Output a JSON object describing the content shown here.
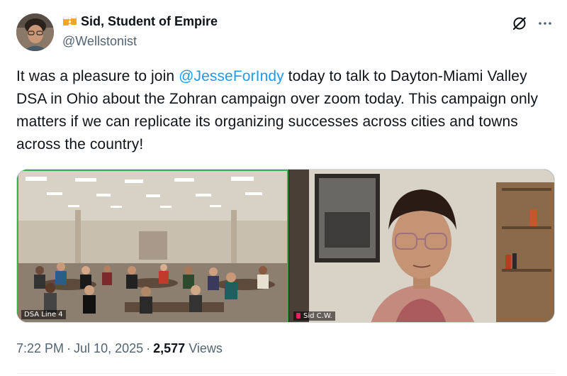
{
  "author": {
    "display_name": "Sid, Student of Empire",
    "handle": "@Wellstonist"
  },
  "tweet": {
    "text_part1": "It was a pleasure to join ",
    "mention": "@JesseForIndy",
    "text_part2": " today to talk to Dayton-Miami Valley DSA in Ohio about the Zohran campaign over zoom today. This campaign only matters if we can replicate its organizing successes across cities and towns across the country!"
  },
  "media": {
    "left_label": "DSA Line 4",
    "right_label": "Sid C.W.",
    "active_speaker_color": "#36b24a"
  },
  "meta": {
    "time": "7:22 PM",
    "date": "Jul 10, 2025",
    "separator": "·",
    "views_count": "2,577",
    "views_label": "Views"
  },
  "icons": {
    "emoji": "beer-mugs-icon",
    "grok": "grok-icon",
    "more": "more-icon"
  },
  "colors": {
    "link": "#1d9bf0",
    "secondary_text": "#536471",
    "primary_text": "#0f1419"
  }
}
